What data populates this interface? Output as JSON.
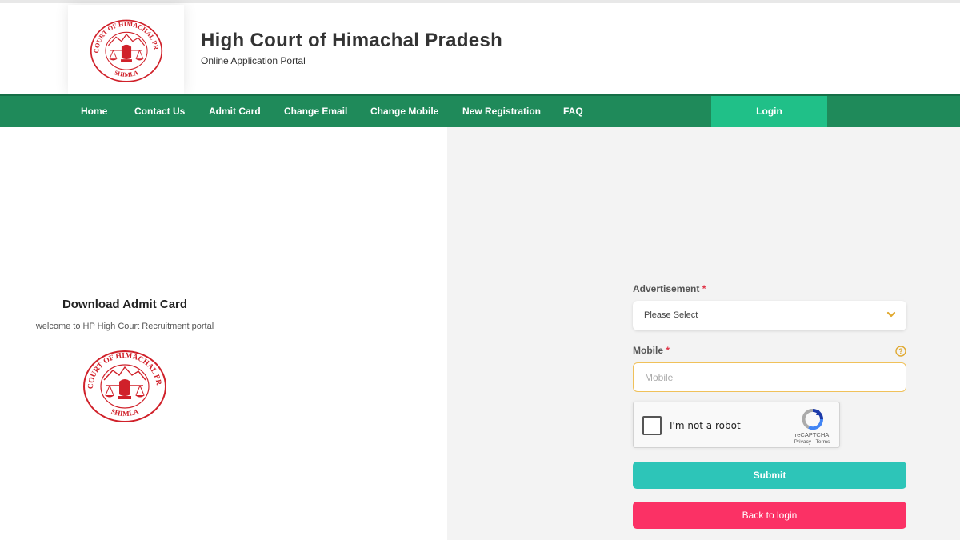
{
  "header": {
    "title": "High Court of Himachal Pradesh",
    "subtitle": "Online Application Portal",
    "emblem_top_text": "HIGH COURT OF HIMACHAL PRADESH",
    "emblem_bottom_text": "SHIMLA"
  },
  "nav": {
    "items": [
      {
        "label": "Home"
      },
      {
        "label": "Contact Us"
      },
      {
        "label": "Admit Card"
      },
      {
        "label": "Change Email"
      },
      {
        "label": "Change Mobile"
      },
      {
        "label": "New Registration"
      },
      {
        "label": "FAQ"
      }
    ],
    "login_label": "Login"
  },
  "left": {
    "title": "Download Admit Card",
    "subtitle": "welcome to HP High Court Recruitment portal"
  },
  "form": {
    "advertisement_label": "Advertisement",
    "advertisement_value": "Please Select",
    "mobile_label": "Mobile",
    "mobile_placeholder": "Mobile",
    "mobile_value": "",
    "required_mark": "*",
    "help_icon": "question-circle-icon",
    "captcha": {
      "label": "I'm not a robot",
      "brand": "reCAPTCHA",
      "links": "Privacy - Terms"
    },
    "submit_label": "Submit",
    "back_label": "Back to login"
  },
  "colors": {
    "nav_bg": "#1f8a5a",
    "login_bg": "#20c088",
    "submit_bg": "#2dc5b8",
    "back_bg": "#fb3165",
    "emblem_red": "#d0212a",
    "required_red": "#e03548",
    "accent_yellow": "#f0c15a"
  }
}
